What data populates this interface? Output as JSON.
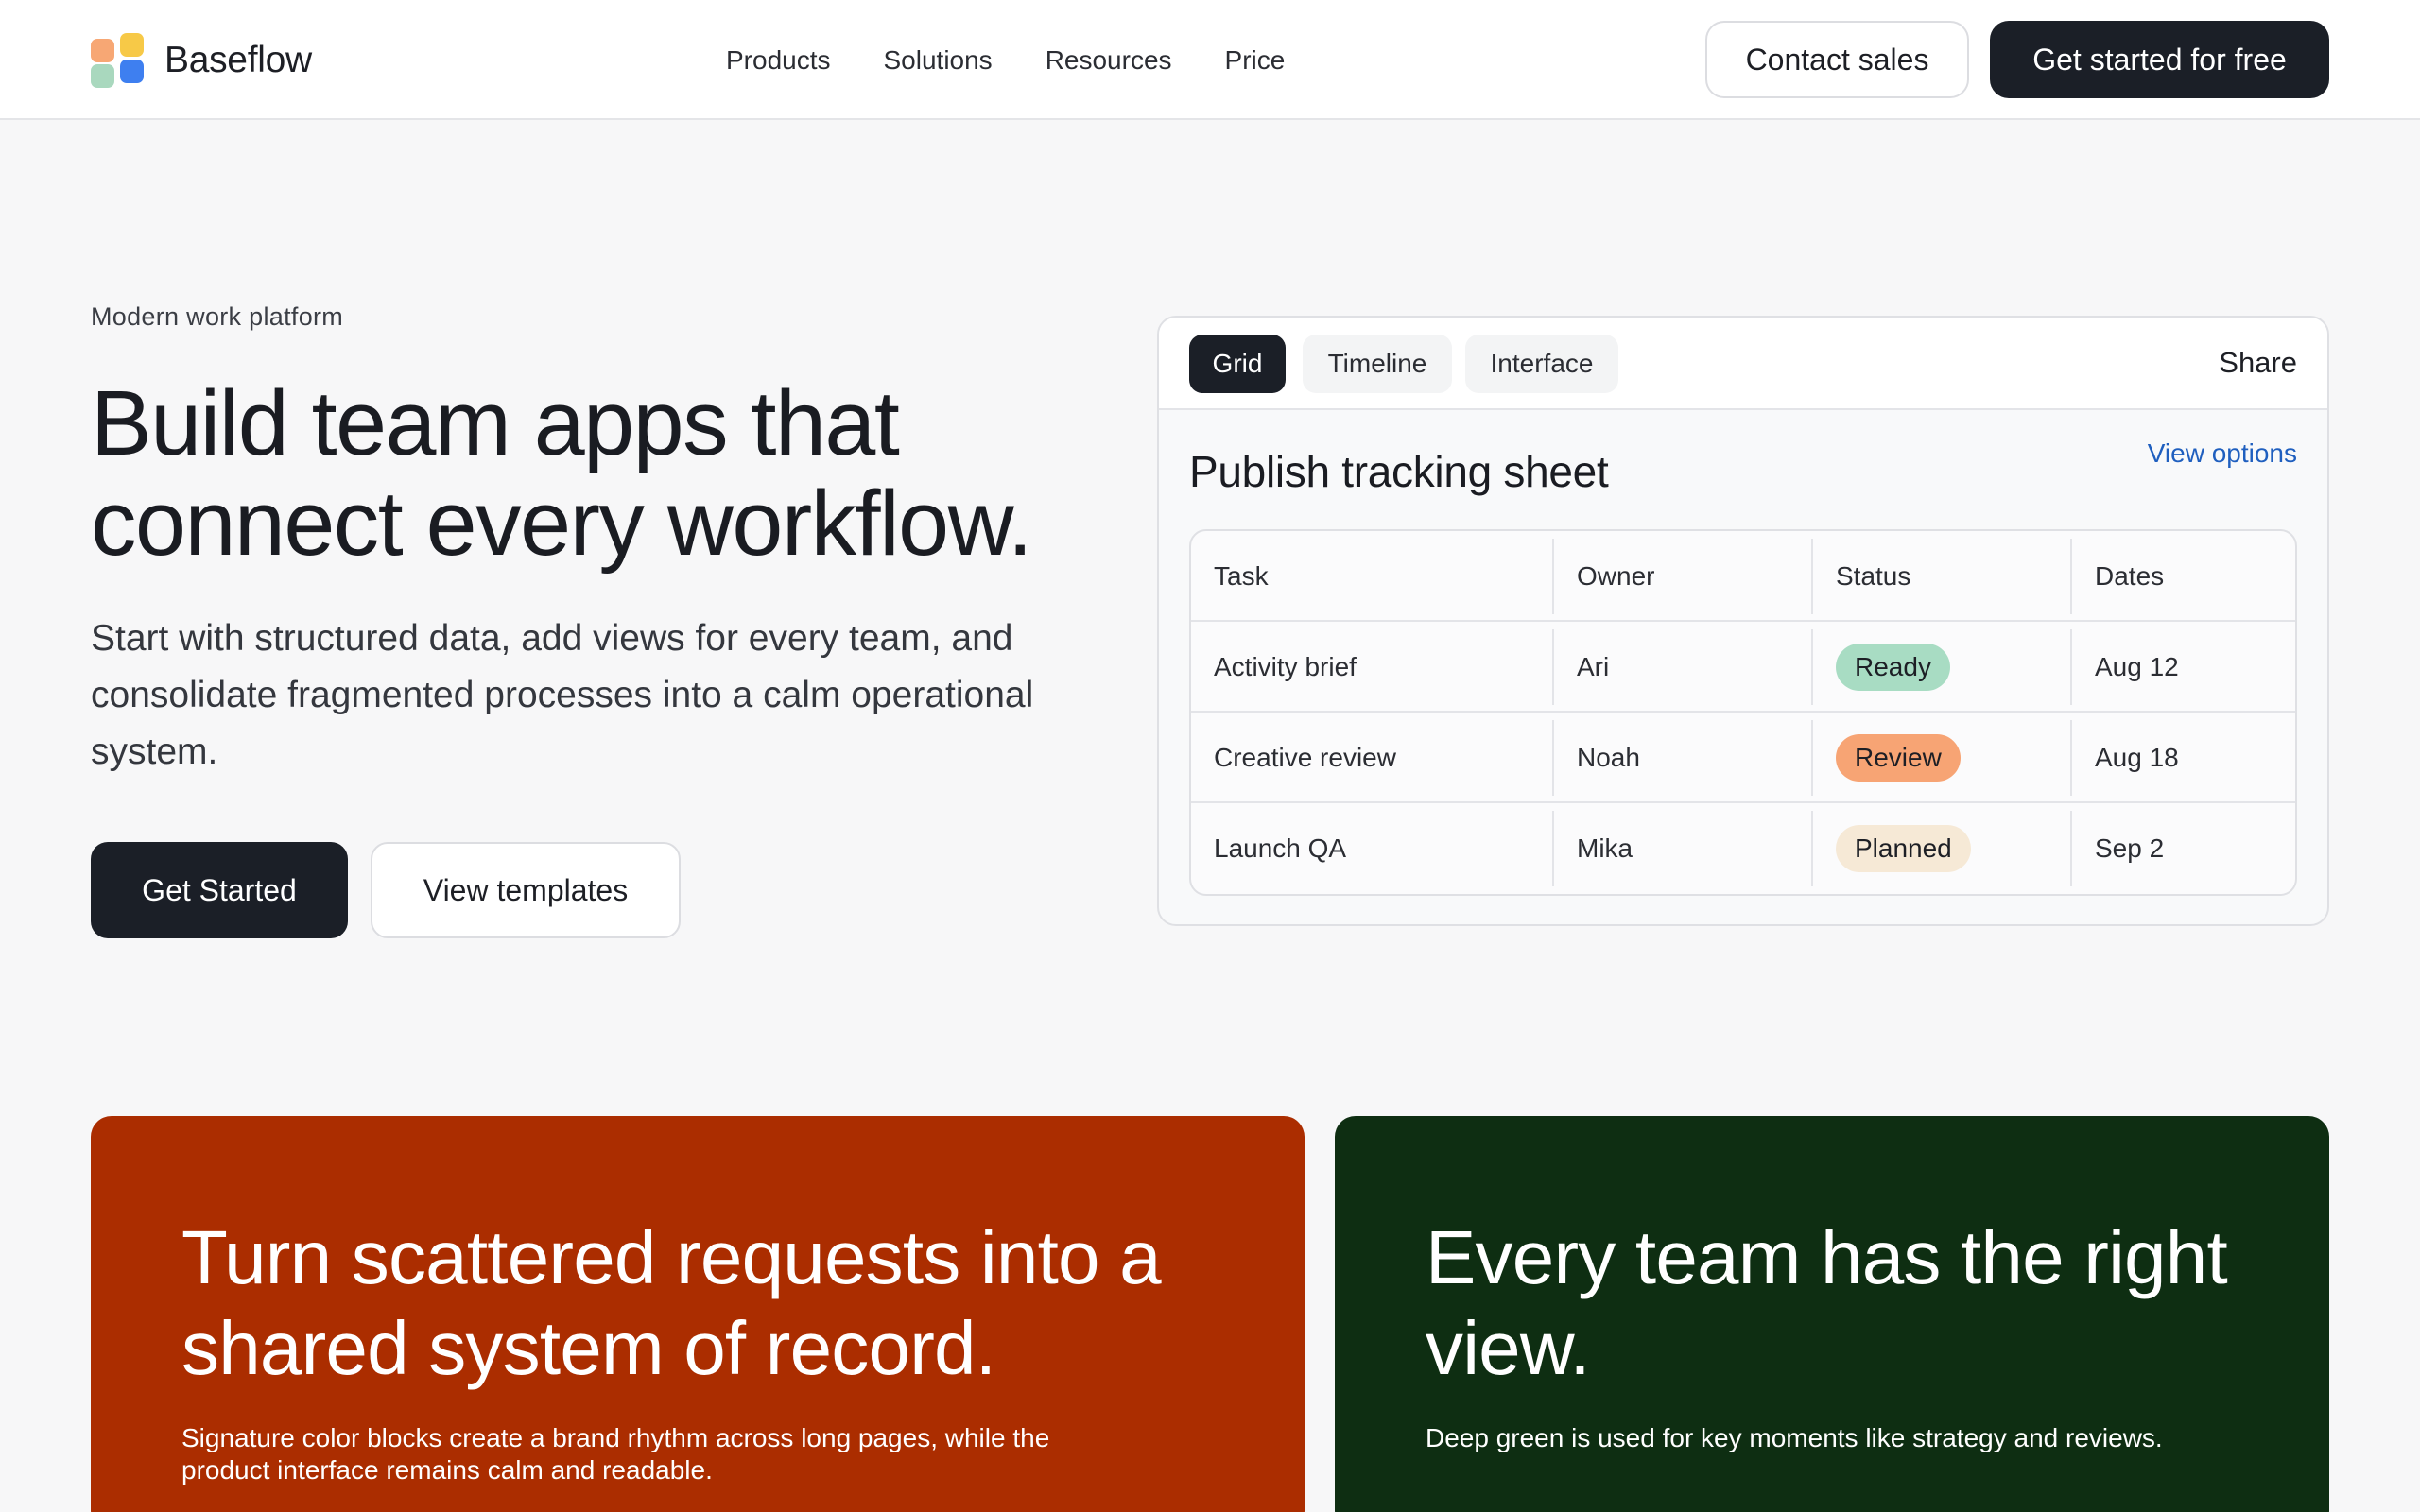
{
  "brand": {
    "name": "Baseflow",
    "logo_colors": [
      "#f7a774",
      "#f7c947",
      "#a9d8be",
      "#3e7ff0"
    ]
  },
  "nav": {
    "links": [
      "Products",
      "Solutions",
      "Resources",
      "Price"
    ],
    "contact_label": "Contact sales",
    "cta_label": "Get started for free"
  },
  "hero": {
    "eyebrow": "Modern work platform",
    "headline": "Build team apps that connect every workflow.",
    "lead": "Start with structured data, add views for every team, and consolidate fragmented processes into a calm operational system.",
    "primary_label": "Get Started",
    "secondary_label": "View templates"
  },
  "card": {
    "tabs": [
      "Grid",
      "Timeline",
      "Interface"
    ],
    "active_tab": "Grid",
    "share_label": "Share",
    "title": "Publish tracking sheet",
    "view_options_label": "View options",
    "columns": [
      "Task",
      "Owner",
      "Status",
      "Dates"
    ],
    "rows": [
      {
        "task": "Activity brief",
        "owner": "Ari",
        "status": "Ready",
        "status_color": "#a8dcc3",
        "date": "Aug 12"
      },
      {
        "task": "Creative review",
        "owner": "Noah",
        "status": "Review",
        "status_color": "#f7a474",
        "date": "Aug 18"
      },
      {
        "task": "Launch QA",
        "owner": "Mika",
        "status": "Planned",
        "status_color": "#f6e9d6",
        "date": "Sep 2"
      }
    ]
  },
  "blocks": [
    {
      "title": "Turn scattered requests into a shared system of record.",
      "text": "Signature color blocks create a brand rhythm across long pages, while the product interface remains calm and readable.",
      "color": "#ab2d00"
    },
    {
      "title": "Every team has the right view.",
      "text": "Deep green is used for key moments like strategy and reviews.",
      "color": "#0e2e12"
    }
  ]
}
